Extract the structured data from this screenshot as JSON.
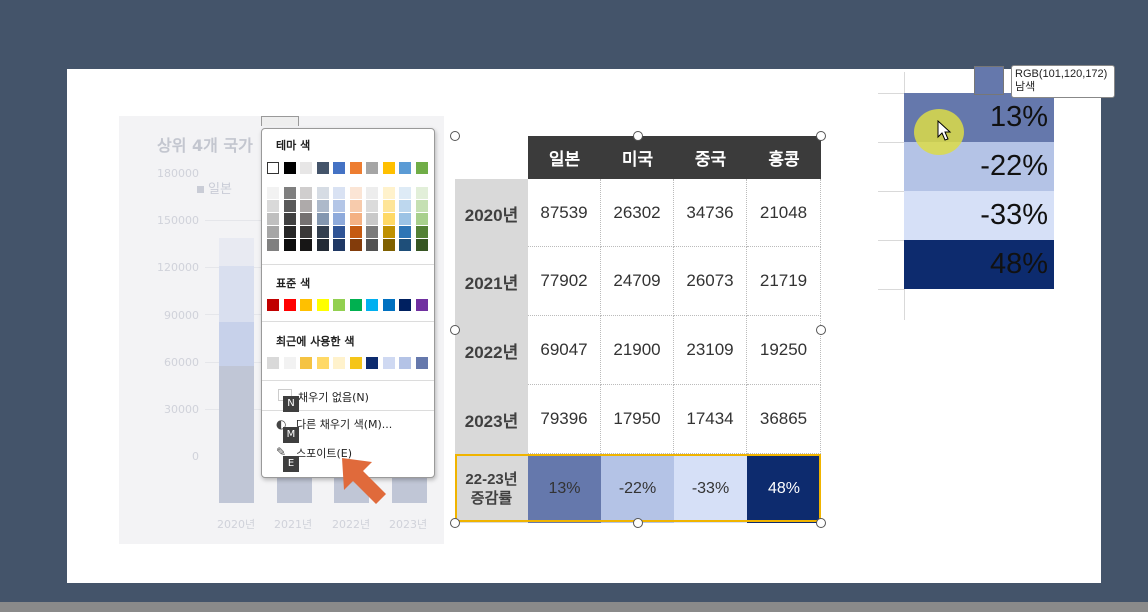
{
  "bg_chart": {
    "title": "상위 4개 국가",
    "legend_label": "일본",
    "y_ticks": [
      "180000",
      "150000",
      "120000",
      "90000",
      "60000",
      "30000",
      "0"
    ],
    "x_ticks": [
      "2020년",
      "2021년",
      "2022년",
      "2023년"
    ]
  },
  "dropdown": {
    "theme_colors_label": "테마 색",
    "theme_top_row": [
      "#ffffff",
      "#000000",
      "#e7e6e6",
      "#44546a",
      "#4472c4",
      "#ed7d31",
      "#a5a5a5",
      "#ffc000",
      "#5b9bd5",
      "#70ad47"
    ],
    "standard_colors_label": "표준 색",
    "standard_colors": [
      "#c00000",
      "#ff0000",
      "#ffc000",
      "#ffff00",
      "#92d050",
      "#00b050",
      "#00b0f0",
      "#0070c0",
      "#002060",
      "#7030a0"
    ],
    "recent_colors_label": "최근에 사용한 색",
    "recent_colors": [
      "#d9d9d9",
      "#f2f2f2",
      "#f5c342",
      "#ffd966",
      "#fff2cc",
      "#f5c518",
      "#0d2b6e",
      "#cfd9f2",
      "#b4c3e6",
      "#6578ac"
    ],
    "no_fill": "채우기 없음(N)",
    "no_fill_key": "N",
    "more_colors": "다른 채우기 색(M)...",
    "more_colors_key": "M",
    "eyedropper": "스포이트(E)",
    "eyedropper_key": "E"
  },
  "table": {
    "columns": [
      "일본",
      "미국",
      "중국",
      "홍콩"
    ],
    "rows": [
      {
        "label": "2020년",
        "values": [
          "87539",
          "26302",
          "34736",
          "21048"
        ]
      },
      {
        "label": "2021년",
        "values": [
          "77902",
          "24709",
          "26073",
          "21719"
        ]
      },
      {
        "label": "2022년",
        "values": [
          "69047",
          "21900",
          "23109",
          "19250"
        ]
      },
      {
        "label": "2023년",
        "values": [
          "79396",
          "17950",
          "17434",
          "36865"
        ]
      }
    ],
    "rate_label_line1": "22-23년",
    "rate_label_line2": "증감률",
    "rates": [
      "13%",
      "-22%",
      "-33%",
      "48%"
    ],
    "rate_colors": [
      "#6578ac",
      "#b4c3e6",
      "#d6e0f7",
      "#0d2b6e"
    ]
  },
  "preview": {
    "rates": [
      "13%",
      "-22%",
      "-33%",
      "48%"
    ],
    "colors": [
      "#6578ac",
      "#b4c3e6",
      "#d6e0f7",
      "#0d2b6e"
    ],
    "tooltip_rgb": "RGB(101,120,172)",
    "tooltip_name": "남색",
    "tooltip_color": "#6578ac"
  },
  "colors": {
    "header_bg": "#3b3b3b",
    "selection_outline": "#f0b400",
    "arrow": "#e06a3b"
  }
}
